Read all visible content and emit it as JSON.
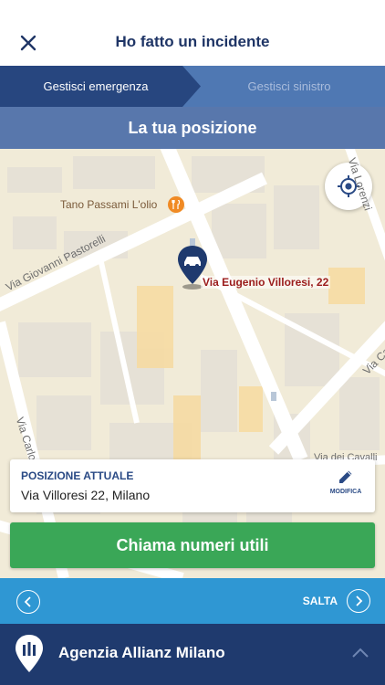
{
  "header": {
    "title": "Ho fatto un incidente",
    "close_icon": "close-icon"
  },
  "steps": [
    {
      "label": "Gestisci emergenza",
      "active": true
    },
    {
      "label": "Gestisci sinistro",
      "active": false
    }
  ],
  "section": {
    "title": "La tua posizione"
  },
  "map": {
    "poi_label": "Tano Passami L'olio",
    "poi_icon": "restaurant-icon",
    "streets": {
      "pastorelli": "Via Giovanni Pastorelli",
      "carlo_left": "Via Carlo",
      "carlo_right": "Via Carlo",
      "lorenzi": "Via Lorenzi",
      "dei_cavalli": "Via dei Cavalli"
    },
    "pin_address": "Via Eugenio Villoresi, 22",
    "pin_icon": "car-pin-icon",
    "locate_icon": "gps-locate-icon"
  },
  "position_card": {
    "label": "POSIZIONE ATTUALE",
    "value": "Via Villoresi 22, Milano",
    "edit_label": "MODIFICA",
    "edit_icon": "pencil-icon"
  },
  "actions": {
    "call_label": "Chiama numeri utili"
  },
  "nav": {
    "back_icon": "chevron-left-icon",
    "skip_label": "SALTA",
    "skip_icon": "chevron-right-icon"
  },
  "agency": {
    "name": "Agenzia Allianz Milano",
    "icon": "allianz-pin-icon",
    "toggle_icon": "chevron-up-icon"
  },
  "colors": {
    "primary_dark": "#1f3a6e",
    "step_active": "#27467f",
    "step_bar": "#4f78b3",
    "section_bar": "#5877ac",
    "call_green": "#3aa757",
    "nav_blue": "#2f97d3",
    "address_red": "#9b1c1c"
  }
}
